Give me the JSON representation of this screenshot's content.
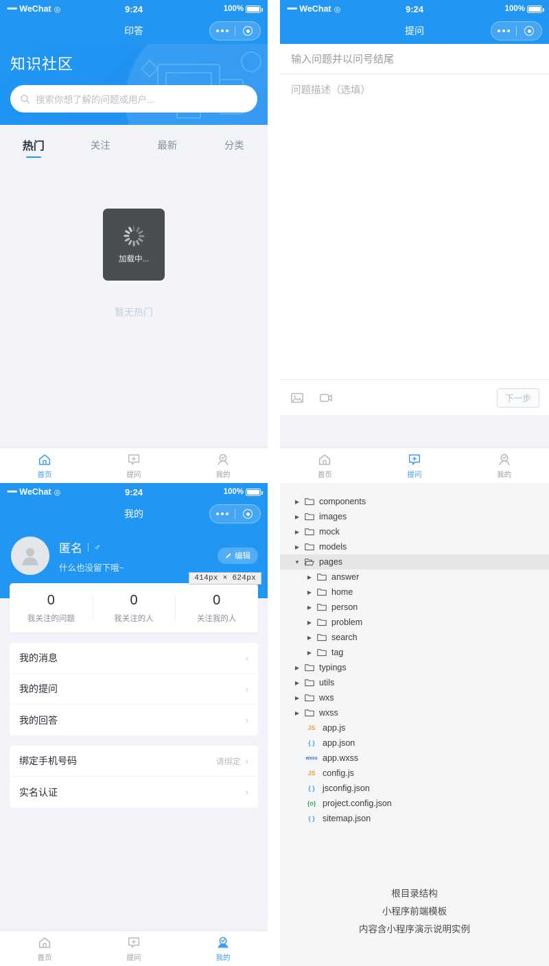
{
  "status_bar": {
    "carrier": "WeChat",
    "dots": "•••••",
    "wifi_icon": "wifi-icon",
    "time": "9:24",
    "battery_percent": "100%"
  },
  "panel_home": {
    "nav_title": "印答",
    "hero_title": "知识社区",
    "search_placeholder": "搜索你想了解的问题或用户...",
    "search_icon": "search-icon",
    "tabs": [
      {
        "label": "热门",
        "active": true
      },
      {
        "label": "关注",
        "active": false
      },
      {
        "label": "最新",
        "active": false
      },
      {
        "label": "分类",
        "active": false
      }
    ],
    "loading_label": "加载中...",
    "empty_text": "暂无热门",
    "tabbar": [
      {
        "label": "首页",
        "icon": "home-icon",
        "active": true
      },
      {
        "label": "提问",
        "icon": "ask-bubble-plus-icon",
        "active": false
      },
      {
        "label": "我的",
        "icon": "user-circle-icon",
        "active": false
      }
    ]
  },
  "panel_ask": {
    "nav_title": "提问",
    "title_placeholder": "输入问题并以问号结尾",
    "desc_placeholder": "问题描述（选填）",
    "toolbar": {
      "image_icon": "image-icon",
      "video_icon": "video-icon",
      "next_label": "下一步"
    },
    "tabbar": [
      {
        "label": "首页",
        "icon": "home-icon",
        "active": false
      },
      {
        "label": "提问",
        "icon": "ask-bubble-plus-icon",
        "active": true
      },
      {
        "label": "我的",
        "icon": "user-circle-icon",
        "active": false
      }
    ]
  },
  "panel_profile": {
    "nav_title": "我的",
    "avatar_icon": "avatar-placeholder-icon",
    "name": "匿名",
    "gender_icon": "♂",
    "signature": "什么也没留下哦~",
    "edit_label": "编辑",
    "edit_icon": "pencil-icon",
    "size_tooltip": "414px × 624px",
    "stats": [
      {
        "value": "0",
        "label": "我关注的问题"
      },
      {
        "value": "0",
        "label": "我关注的人"
      },
      {
        "value": "0",
        "label": "关注我的人"
      }
    ],
    "menu_group_1": [
      {
        "label": "我的消息",
        "hint": ""
      },
      {
        "label": "我的提问",
        "hint": ""
      },
      {
        "label": "我的回答",
        "hint": ""
      }
    ],
    "menu_group_2": [
      {
        "label": "绑定手机号码",
        "hint": "请绑定"
      },
      {
        "label": "实名认证",
        "hint": ""
      }
    ],
    "chevron": "›",
    "tabbar": [
      {
        "label": "首页",
        "icon": "home-icon",
        "active": false
      },
      {
        "label": "提问",
        "icon": "ask-bubble-plus-icon",
        "active": false
      },
      {
        "label": "我的",
        "icon": "user-circle-icon",
        "active": true
      }
    ]
  },
  "panel_files": {
    "tree": [
      {
        "name": "components",
        "type": "folder",
        "depth": 0,
        "expanded": false,
        "selected": false
      },
      {
        "name": "images",
        "type": "folder",
        "depth": 0,
        "expanded": false,
        "selected": false
      },
      {
        "name": "mock",
        "type": "folder",
        "depth": 0,
        "expanded": false,
        "selected": false
      },
      {
        "name": "models",
        "type": "folder",
        "depth": 0,
        "expanded": false,
        "selected": false
      },
      {
        "name": "pages",
        "type": "folder",
        "depth": 0,
        "expanded": true,
        "selected": true
      },
      {
        "name": "answer",
        "type": "folder",
        "depth": 1,
        "expanded": false,
        "selected": false
      },
      {
        "name": "home",
        "type": "folder",
        "depth": 1,
        "expanded": false,
        "selected": false
      },
      {
        "name": "person",
        "type": "folder",
        "depth": 1,
        "expanded": false,
        "selected": false
      },
      {
        "name": "problem",
        "type": "folder",
        "depth": 1,
        "expanded": false,
        "selected": false
      },
      {
        "name": "search",
        "type": "folder",
        "depth": 1,
        "expanded": false,
        "selected": false
      },
      {
        "name": "tag",
        "type": "folder",
        "depth": 1,
        "expanded": false,
        "selected": false
      },
      {
        "name": "typings",
        "type": "folder",
        "depth": 0,
        "expanded": false,
        "selected": false
      },
      {
        "name": "utils",
        "type": "folder",
        "depth": 0,
        "expanded": false,
        "selected": false
      },
      {
        "name": "wxs",
        "type": "folder",
        "depth": 0,
        "expanded": false,
        "selected": false
      },
      {
        "name": "wxss",
        "type": "folder",
        "depth": 0,
        "expanded": false,
        "selected": false
      },
      {
        "name": "app.js",
        "type": "file",
        "depth": 0,
        "badge": "JS",
        "badge_color": "#e8a33d"
      },
      {
        "name": "app.json",
        "type": "file",
        "depth": 0,
        "badge": "{ }",
        "badge_color": "#3ba3e8"
      },
      {
        "name": "app.wxss",
        "type": "file",
        "depth": 0,
        "badge": "wxss",
        "badge_color": "#2d6ecb"
      },
      {
        "name": "config.js",
        "type": "file",
        "depth": 0,
        "badge": "JS",
        "badge_color": "#e8a33d"
      },
      {
        "name": "jsconfig.json",
        "type": "file",
        "depth": 0,
        "badge": "{ }",
        "badge_color": "#3ba3e8"
      },
      {
        "name": "project.config.json",
        "type": "file",
        "depth": 0,
        "badge": "{o}",
        "badge_color": "#2eab5a"
      },
      {
        "name": "sitemap.json",
        "type": "file",
        "depth": 0,
        "badge": "{ }",
        "badge_color": "#3ba3e8"
      }
    ],
    "caption_lines": [
      "根目录结构",
      "小程序前端模板",
      "内容含小程序演示说明实例"
    ]
  },
  "colors": {
    "brand_blue": "#2196f3",
    "tab_active_blue": "#3c9cf6",
    "page_bg": "#f2f4f9",
    "ide_bg": "#f5f6f8"
  }
}
